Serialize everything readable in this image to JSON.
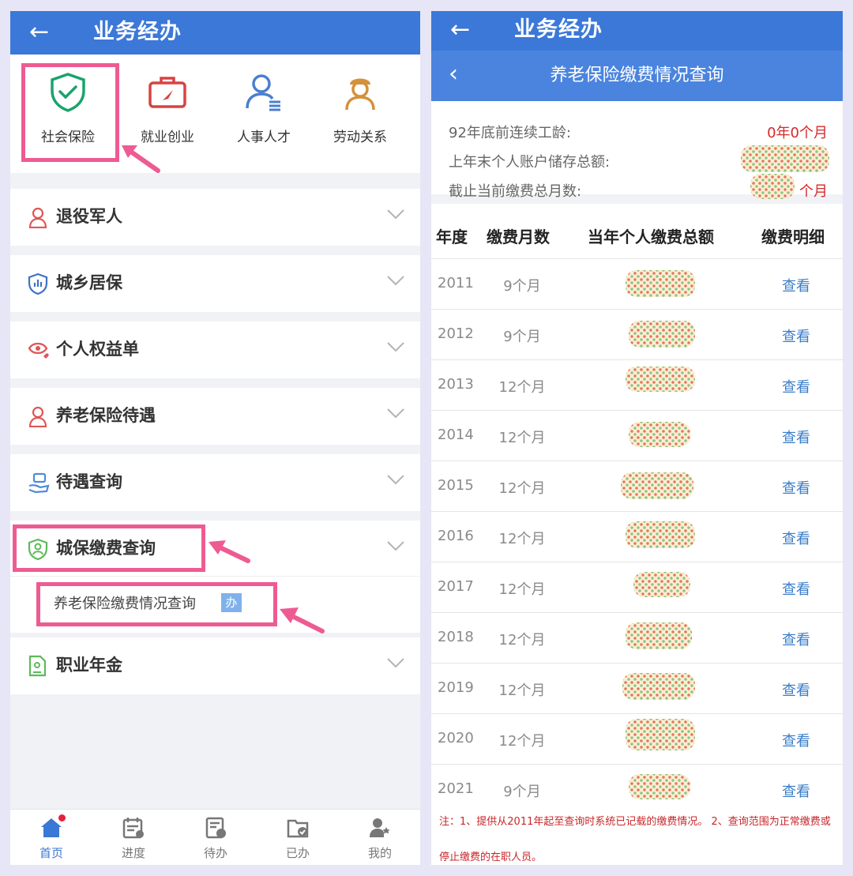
{
  "left": {
    "header": {
      "back_icon": "arrow-left-icon",
      "title": "业务经办"
    },
    "quick_icons": [
      {
        "label": "社会保险",
        "icon": "shield-check-icon",
        "color": "#1aa36b"
      },
      {
        "label": "就业创业",
        "icon": "briefcase-icon",
        "color": "#d94242"
      },
      {
        "label": "人事人才",
        "icon": "person-list-icon",
        "color": "#4a7fd0"
      },
      {
        "label": "劳动关系",
        "icon": "worker-icon",
        "color": "#d5903b"
      }
    ],
    "sections": [
      {
        "label": "退役军人",
        "icon": "veteran-icon"
      },
      {
        "label": "城乡居保",
        "icon": "shield-chart-icon"
      },
      {
        "label": "个人权益单",
        "icon": "eye-heart-icon"
      },
      {
        "label": "养老保险待遇",
        "icon": "elder-icon"
      },
      {
        "label": "待遇查询",
        "icon": "hand-card-icon"
      },
      {
        "label": "城保缴费查询",
        "icon": "shield-person-icon",
        "expanded": true,
        "children": [
          {
            "label": "养老保险缴费情况查询",
            "badge": "办"
          }
        ]
      },
      {
        "label": "职业年金",
        "icon": "document-person-icon"
      }
    ],
    "tabbar": [
      {
        "label": "首页",
        "icon": "home-icon",
        "active": true
      },
      {
        "label": "进度",
        "icon": "calendar-icon"
      },
      {
        "label": "待办",
        "icon": "pending-doc-icon"
      },
      {
        "label": "已办",
        "icon": "done-folder-icon"
      },
      {
        "label": "我的",
        "icon": "user-stars-icon"
      }
    ]
  },
  "right": {
    "header": {
      "back_icon": "arrow-left-icon",
      "title": "业务经办"
    },
    "subheader": {
      "back_icon": "chevron-left-icon",
      "title": "养老保险缴费情况查询"
    },
    "info": [
      {
        "label": "92年底前连续工龄:",
        "value": "0年0个月"
      },
      {
        "label": "上年末个人账户储存总额:",
        "value": ""
      },
      {
        "label": "截止当前缴费总月数:",
        "value": "个月"
      }
    ],
    "table": {
      "columns": [
        "年度",
        "缴费月数",
        "当年个人缴费总额",
        "缴费明细"
      ],
      "rows": [
        {
          "year": "2011",
          "months": "9个月",
          "link": "查看"
        },
        {
          "year": "2012",
          "months": "9个月",
          "link": "查看"
        },
        {
          "year": "2013",
          "months": "12个月",
          "link": "查看"
        },
        {
          "year": "2014",
          "months": "12个月",
          "link": "查看"
        },
        {
          "year": "2015",
          "months": "12个月",
          "link": "查看"
        },
        {
          "year": "2016",
          "months": "12个月",
          "link": "查看"
        },
        {
          "year": "2017",
          "months": "12个月",
          "link": "查看"
        },
        {
          "year": "2018",
          "months": "12个月",
          "link": "查看"
        },
        {
          "year": "2019",
          "months": "12个月",
          "link": "查看"
        },
        {
          "year": "2020",
          "months": "12个月",
          "link": "查看"
        },
        {
          "year": "2021",
          "months": "9个月",
          "link": "查看"
        }
      ]
    },
    "note": "注：1、提供从2011年起至查询时系统已记载的缴费情况。 2、查询范围为正常缴费或停止缴费的在职人员。"
  },
  "colors": {
    "primary": "#3b78d8",
    "highlight": "#ee5b93",
    "link": "#3a7dc8",
    "danger": "#d42a2a"
  }
}
